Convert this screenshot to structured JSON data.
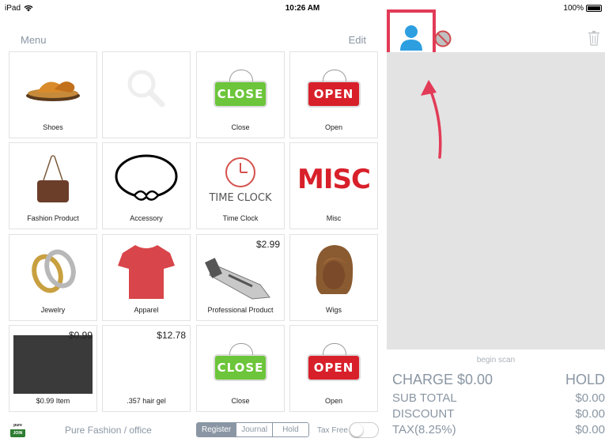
{
  "status_bar": {
    "device": "iPad",
    "time": "10:26 AM",
    "battery": "100%"
  },
  "menu": {
    "title": "Menu",
    "edit": "Edit"
  },
  "tiles": [
    {
      "label": "Shoes",
      "price": ""
    },
    {
      "label": "",
      "price": ""
    },
    {
      "label": "Close",
      "price": "",
      "sign": "CLOSE"
    },
    {
      "label": "Open",
      "price": "",
      "sign": "OPEN"
    },
    {
      "label": "Fashion Product",
      "price": ""
    },
    {
      "label": "Accessory",
      "price": ""
    },
    {
      "label": "Time Clock",
      "price": "",
      "img_text": "TIME CLOCK"
    },
    {
      "label": "Misc",
      "price": "",
      "img_text": "MISC"
    },
    {
      "label": "Jewelry",
      "price": ""
    },
    {
      "label": "Apparel",
      "price": ""
    },
    {
      "label": "Professional Product",
      "price": "$2.99"
    },
    {
      "label": "Wigs",
      "price": ""
    },
    {
      "label": "$0.99 Item",
      "price": "$0.99"
    },
    {
      "label": ".357 hair gel",
      "price": "$12.78"
    },
    {
      "label": "Close",
      "price": "",
      "sign": "CLOSE"
    },
    {
      "label": "Open",
      "price": "",
      "sign": "OPEN"
    }
  ],
  "bottom_bar": {
    "logo_top": "pure",
    "logo_bottom": "JOIN",
    "store_name": "Pure Fashion / office",
    "tabs": [
      "Register",
      "Journal",
      "Hold"
    ],
    "active_tab": "Register",
    "tax_free_label": "Tax Free",
    "tax_free_on": false
  },
  "cart": {
    "begin_scan": "begin scan",
    "charge": "CHARGE $0.00",
    "hold": "HOLD",
    "subtotal_label": "SUB TOTAL",
    "subtotal_value": "$0.00",
    "discount_label": "DISCOUNT",
    "discount_value": "$0.00",
    "tax_label": "TAX(8.25%)",
    "tax_value": "$0.00"
  },
  "colors": {
    "accent_gray": "#8a96a3",
    "highlight": "#e23b57",
    "customer_icon": "#2d9fe0",
    "close_sign": "#6cc53a",
    "open_sign": "#d8202a"
  }
}
